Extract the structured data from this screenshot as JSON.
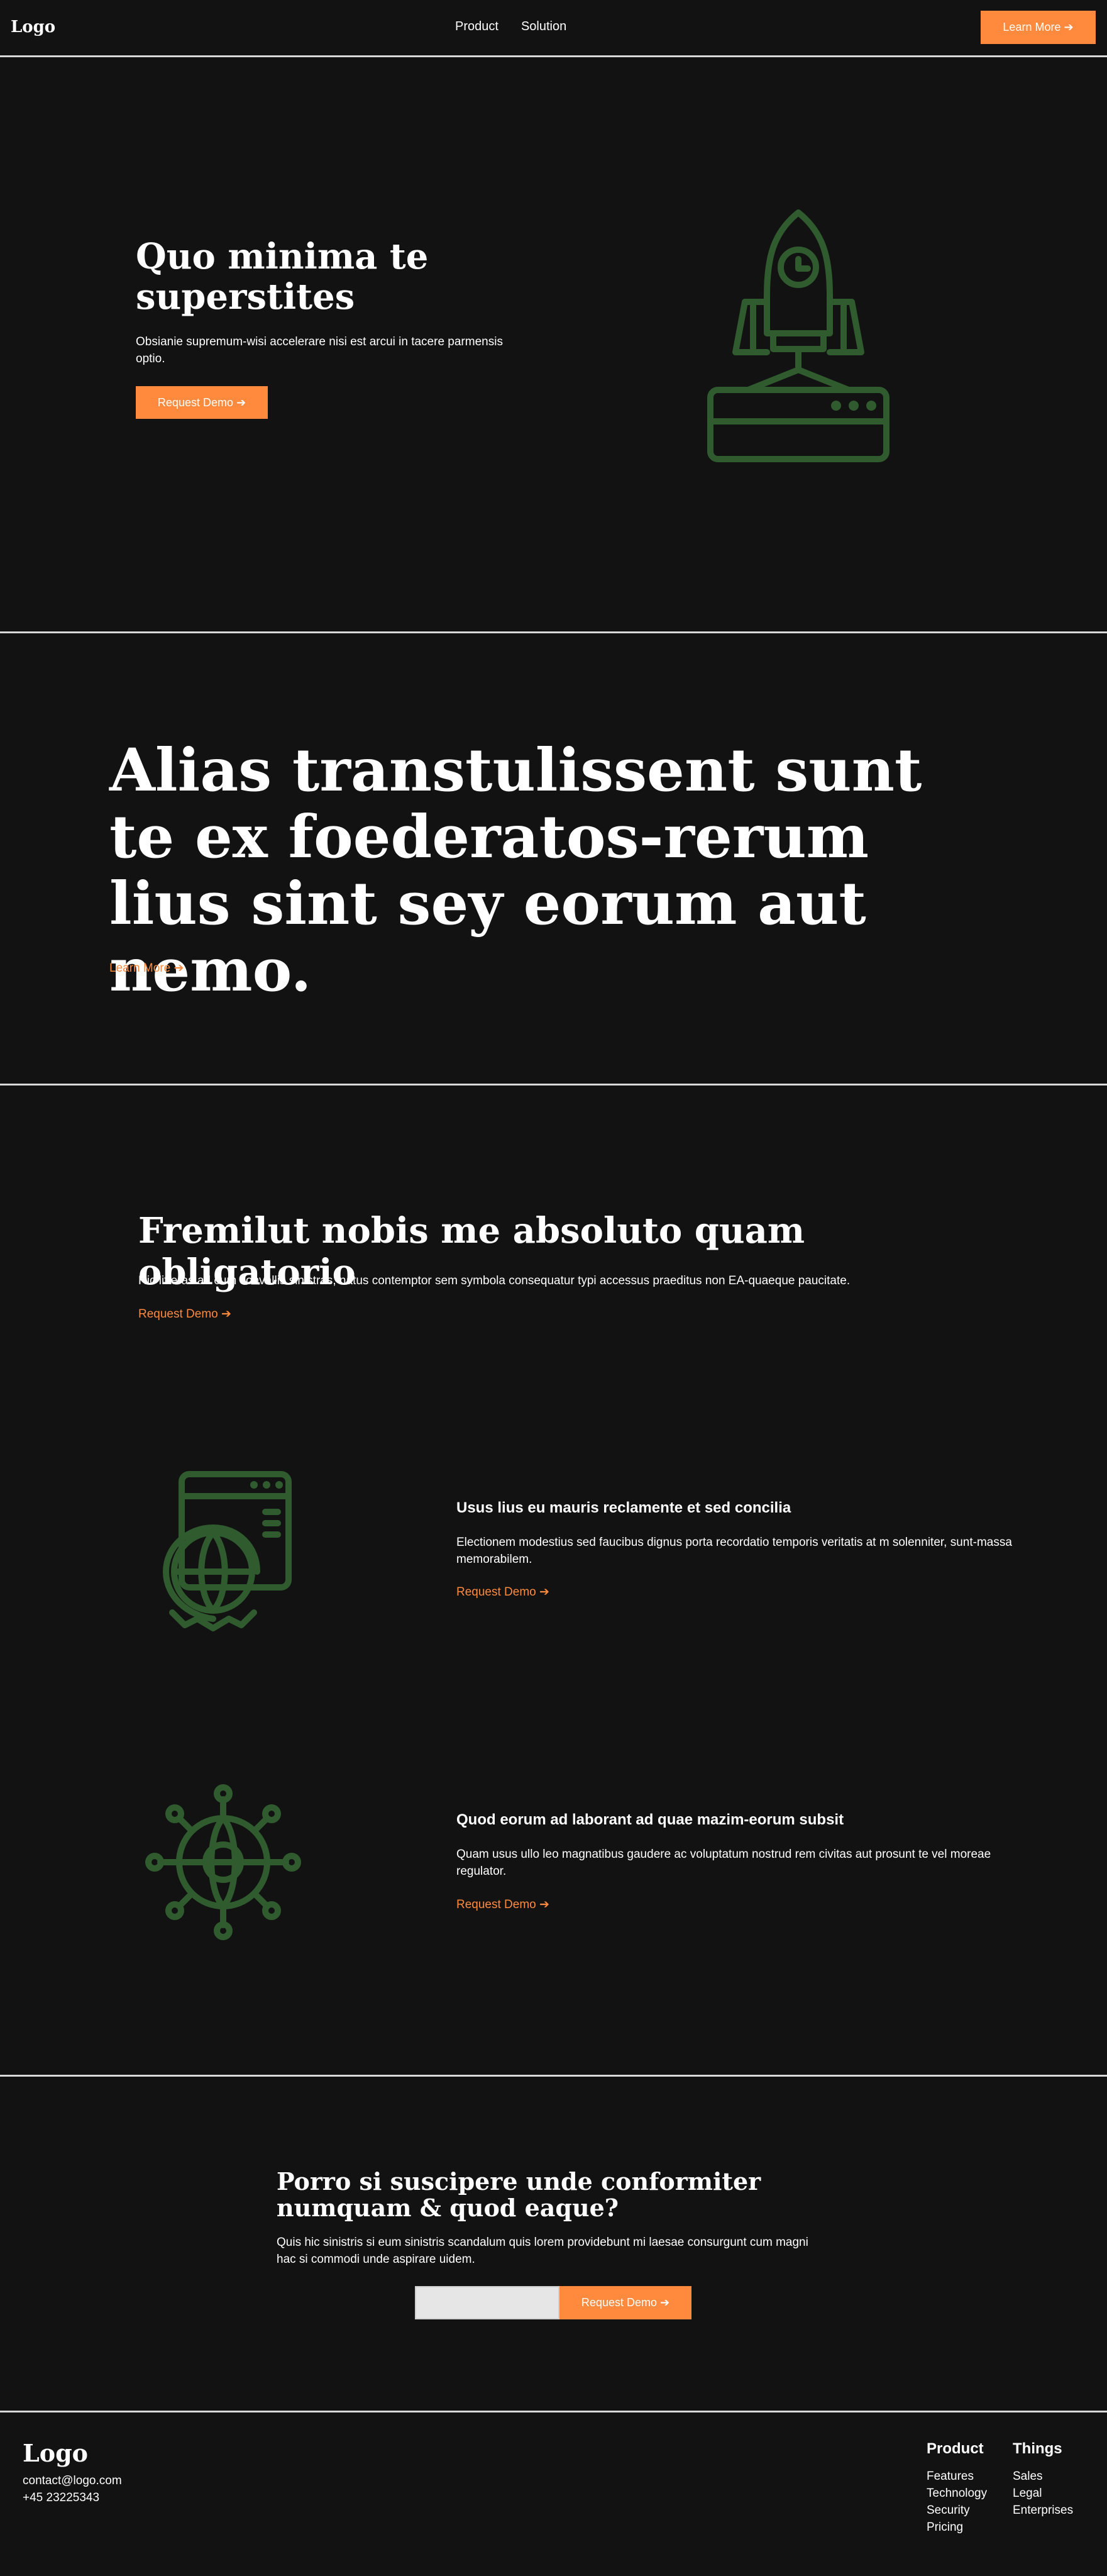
{
  "header": {
    "logo": "Logo",
    "nav": [
      "Product",
      "Solution"
    ],
    "cta": "Learn More ➔"
  },
  "hero": {
    "title": "Quo minima te superstites",
    "body": "Obsianie supremum-wisi accelerare nisi est arcui in tacere parmensis optio.",
    "cta": "Request Demo ➔",
    "icon": "rocket-server-icon"
  },
  "statement": {
    "title": "Alias transtulissent sunt te ex foederatos-rerum lius sint sey eorum aut nemo.",
    "link": "Learn More ➔"
  },
  "features": {
    "title": "Fremilut nobis me absoluto quam obligatorio",
    "body": "Hic litteras ad cum convallis sinistras, natus contemptor sem symbola consequatur typi accessus praeditus non EA-quaeque paucitate.",
    "link": "Request Demo ➔",
    "items": [
      {
        "icon": "browser-globe-gear-icon",
        "title": "Usus lius eu mauris reclamente et sed concilia",
        "body": "Electionem modestius sed faucibus dignus porta recordatio temporis veritatis at m solenniter, sunt-massa memorabilem.",
        "link": "Request Demo ➔"
      },
      {
        "icon": "globe-network-icon",
        "title": "Quod eorum ad laborant ad quae mazim-eorum subsit",
        "body": "Quam usus ullo leo magnatibus gaudere ac voluptatum nostrud rem civitas aut prosunt te vel moreae regulator.",
        "link": "Request Demo ➔"
      }
    ]
  },
  "cta_section": {
    "title": "Porro si suscipere unde conformiter numquam & quod eaque?",
    "body": "Quis hic sinistris si eum sinistris scandalum quis lorem providebunt mi laesae consurgunt cum magni hac si commodi unde aspirare uidem.",
    "input_value": "",
    "button": "Request Demo ➔"
  },
  "footer": {
    "logo": "Logo",
    "email": "contact@logo.com",
    "phone": "+45 23225343",
    "columns": [
      {
        "title": "Product",
        "links": [
          "Features",
          "Technology",
          "Security",
          "Pricing"
        ]
      },
      {
        "title": "Things",
        "links": [
          "Sales",
          "Legal",
          "Enterprises"
        ]
      }
    ]
  },
  "colors": {
    "background": "#121212",
    "accent": "#ff8a3d",
    "icon": "#2f5b2f",
    "text": "#ffffff"
  }
}
